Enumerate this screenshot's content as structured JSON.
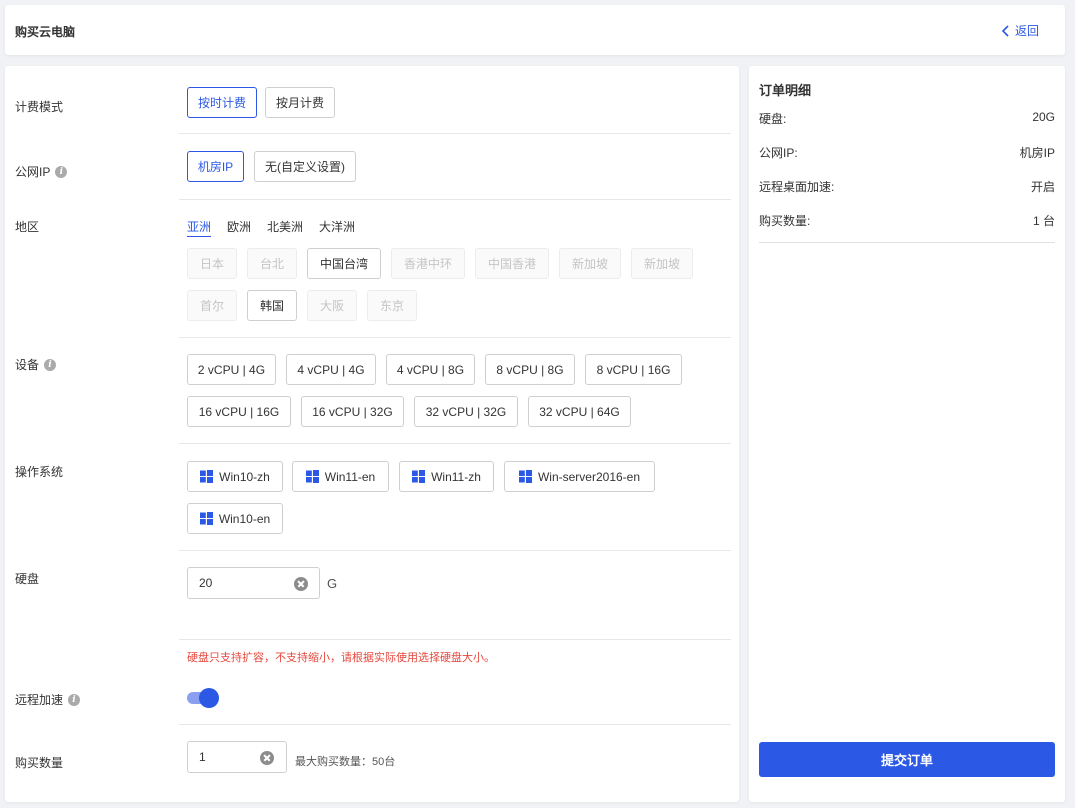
{
  "header": {
    "title": "购买云电脑",
    "back_label": "返回"
  },
  "billing": {
    "label": "计费模式",
    "options": [
      "按时计费",
      "按月计费"
    ],
    "selected": "按时计费"
  },
  "public_ip": {
    "label": "公网IP",
    "options": [
      "机房IP",
      "无(自定义设置)"
    ],
    "selected": "机房IP"
  },
  "region": {
    "label": "地区",
    "tabs": [
      "亚洲",
      "欧洲",
      "北美洲",
      "大洋洲"
    ],
    "active_tab": "亚洲",
    "items": [
      "日本",
      "台北",
      "中国台湾",
      "香港中环",
      "中国香港",
      "新加坡",
      "新加坡",
      "首尔",
      "韩国",
      "大阪",
      "东京"
    ],
    "enabled": [
      "中国台湾",
      "韩国"
    ]
  },
  "device": {
    "label": "设备",
    "options": [
      "2 vCPU | 4G",
      "4 vCPU | 4G",
      "4 vCPU | 8G",
      "8 vCPU | 8G",
      "8 vCPU | 16G",
      "16 vCPU | 16G",
      "16 vCPU | 32G",
      "32 vCPU | 32G",
      "32 vCPU | 64G"
    ]
  },
  "os": {
    "label": "操作系统",
    "options": [
      "Win10-zh",
      "Win11-en",
      "Win11-zh",
      "Win-server2016-en",
      "Win10-en"
    ],
    "icon": "windows-icon",
    "icon_color": "#2b58e5"
  },
  "disk": {
    "label": "硬盘",
    "value": "20",
    "unit": "G",
    "warning": "硬盘只支持扩容，不支持缩小，请根据实际使用选择硬盘大小。"
  },
  "remote_accel": {
    "label": "远程加速",
    "enabled": true
  },
  "quantity": {
    "label": "购买数量",
    "value": "1",
    "hint": "最大购买数量：50台"
  },
  "order": {
    "title": "订单明细",
    "rows": [
      {
        "key": "硬盘:",
        "value": "20G"
      },
      {
        "key": "公网IP:",
        "value": "机房IP"
      },
      {
        "key": "远程桌面加速:",
        "value": "开启"
      },
      {
        "key": "购买数量:",
        "value": "1 台"
      }
    ],
    "submit_label": "提交订单"
  },
  "colors": {
    "accent": "#2b58e5",
    "warning": "#e5483e",
    "toggle_track": "#8a9ff0"
  }
}
